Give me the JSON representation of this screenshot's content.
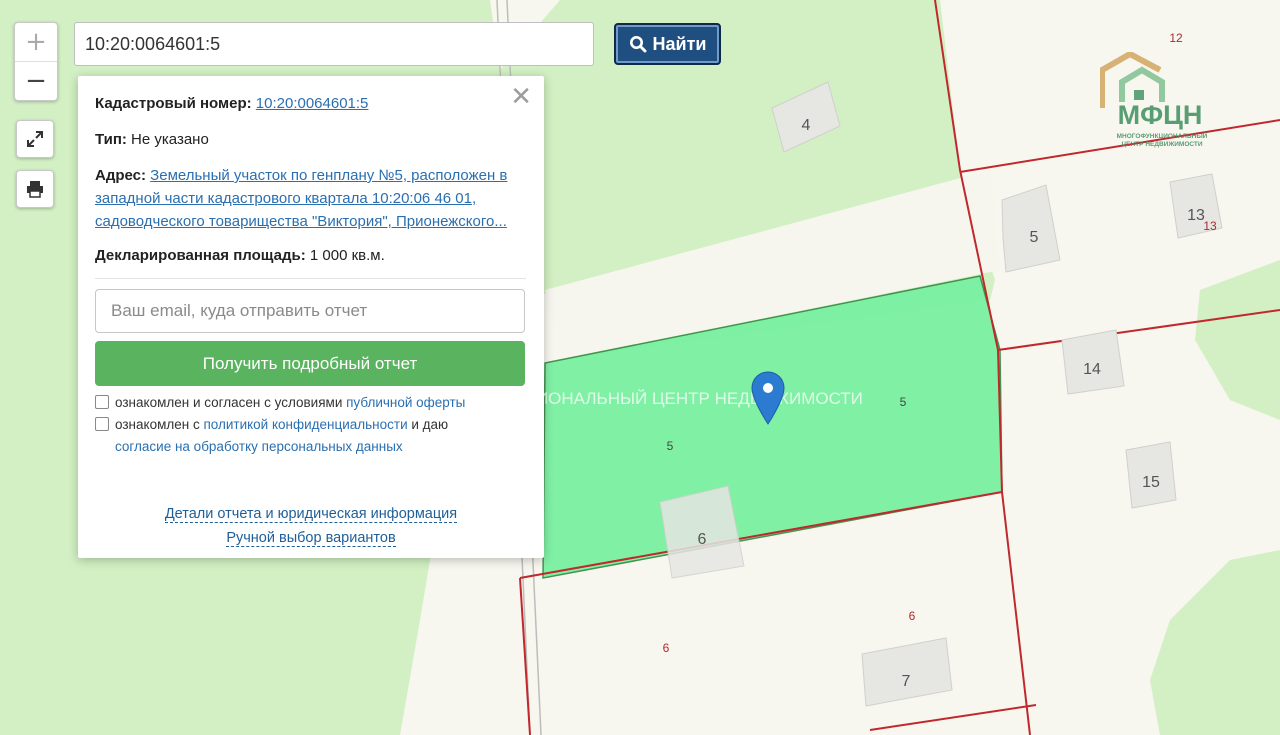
{
  "map": {
    "buildings": [
      "4",
      "5",
      "13",
      "14",
      "15",
      "6",
      "7"
    ],
    "parcel_numbers": [
      "12",
      "13",
      "5",
      "5",
      "6",
      "6"
    ],
    "watermark": "МНОГОФУНКЦИОНАЛЬНЫЙ ЦЕНТР НЕДВИЖИМОСТИ",
    "selected_parcel_color": "#7af0a2",
    "boundary_color": "#c0282d",
    "pin_color": "#2b7bd1"
  },
  "controls": {
    "zoom_in": "+",
    "zoom_out": "−"
  },
  "search": {
    "value": "10:20:0064601:5",
    "button_label": "Найти"
  },
  "popup": {
    "cadastral_label": "Кадастровый номер:",
    "cadastral_value": "10:20:0064601:5",
    "type_label": "Тип:",
    "type_value": "Не указано",
    "address_label": "Адрес:",
    "address_value": "Земельный участок по генплану №5, расположен в западной части кадастрового квартала 10:20:06 46 01, садоводческого товарищества \"Виктория\", Прионежского...",
    "area_label": "Декларированная площадь:",
    "area_value": "1 000 кв.м.",
    "email_placeholder": "Ваш email, куда отправить отчет",
    "report_button": "Получить подробный отчет",
    "consent1_text": "ознакомлен и согласен с условиями ",
    "consent1_link": "публичной оферты",
    "consent2_text_a": "ознакомлен с ",
    "consent2_link_a": "политикой конфиденциальности",
    "consent2_text_b": " и даю",
    "consent2_link_b": "согласие на обработку персональных данных",
    "details_link": "Детали отчета и юридическая информация",
    "manual_link": "Ручной выбор вариантов"
  },
  "logo": {
    "name": "МФЦН",
    "subtitle_line1": "МНОГОФУНКЦИОНАЛЬНЫЙ",
    "subtitle_line2": "ЦЕНТР НЕДВИЖИМОСТИ"
  }
}
